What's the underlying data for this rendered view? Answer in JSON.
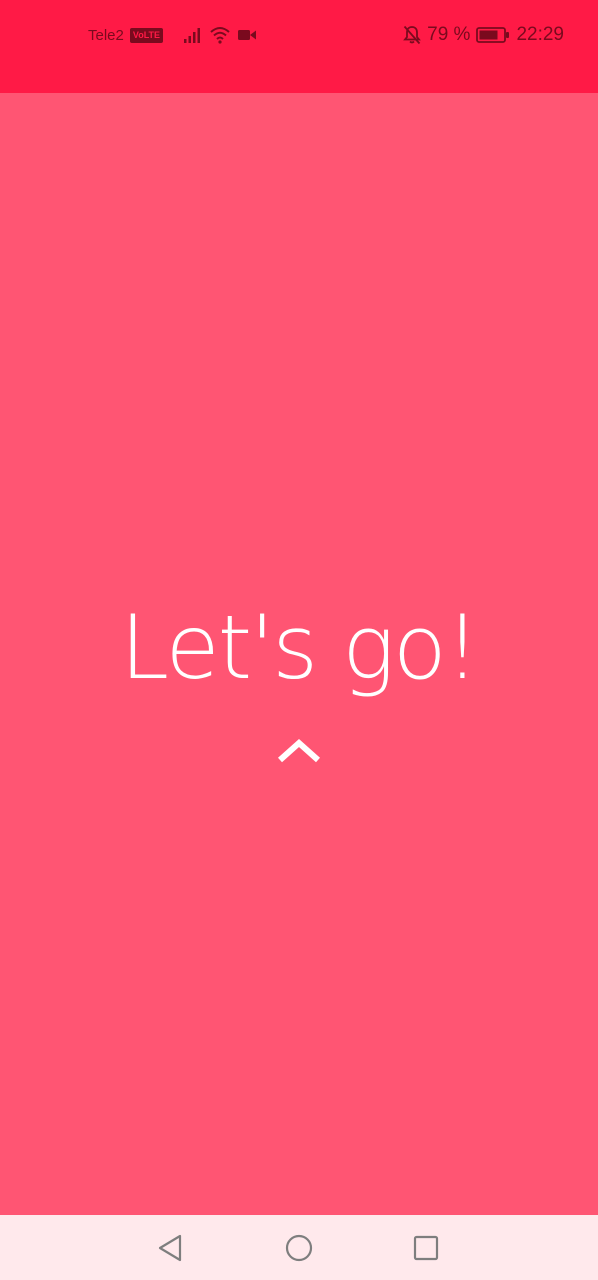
{
  "status_bar": {
    "carrier": "Tele2",
    "volte_badge": "VoLTE",
    "battery_percent": "79 %",
    "time": "22:29",
    "icons": [
      "signal-icon",
      "wifi-icon",
      "video-call-icon",
      "notifications-off-icon",
      "battery-icon"
    ]
  },
  "main": {
    "headline": "Let's go!",
    "swipe_icon": "chevron-up-icon"
  },
  "nav_bar": {
    "icons": [
      "back-icon",
      "home-icon",
      "recent-apps-icon"
    ]
  },
  "colors": {
    "status_bar_bg": "#FF1A46",
    "main_bg": "#FF5573",
    "nav_bar_bg": "#FFE9EC",
    "headline_text": "#FFFFFF"
  }
}
